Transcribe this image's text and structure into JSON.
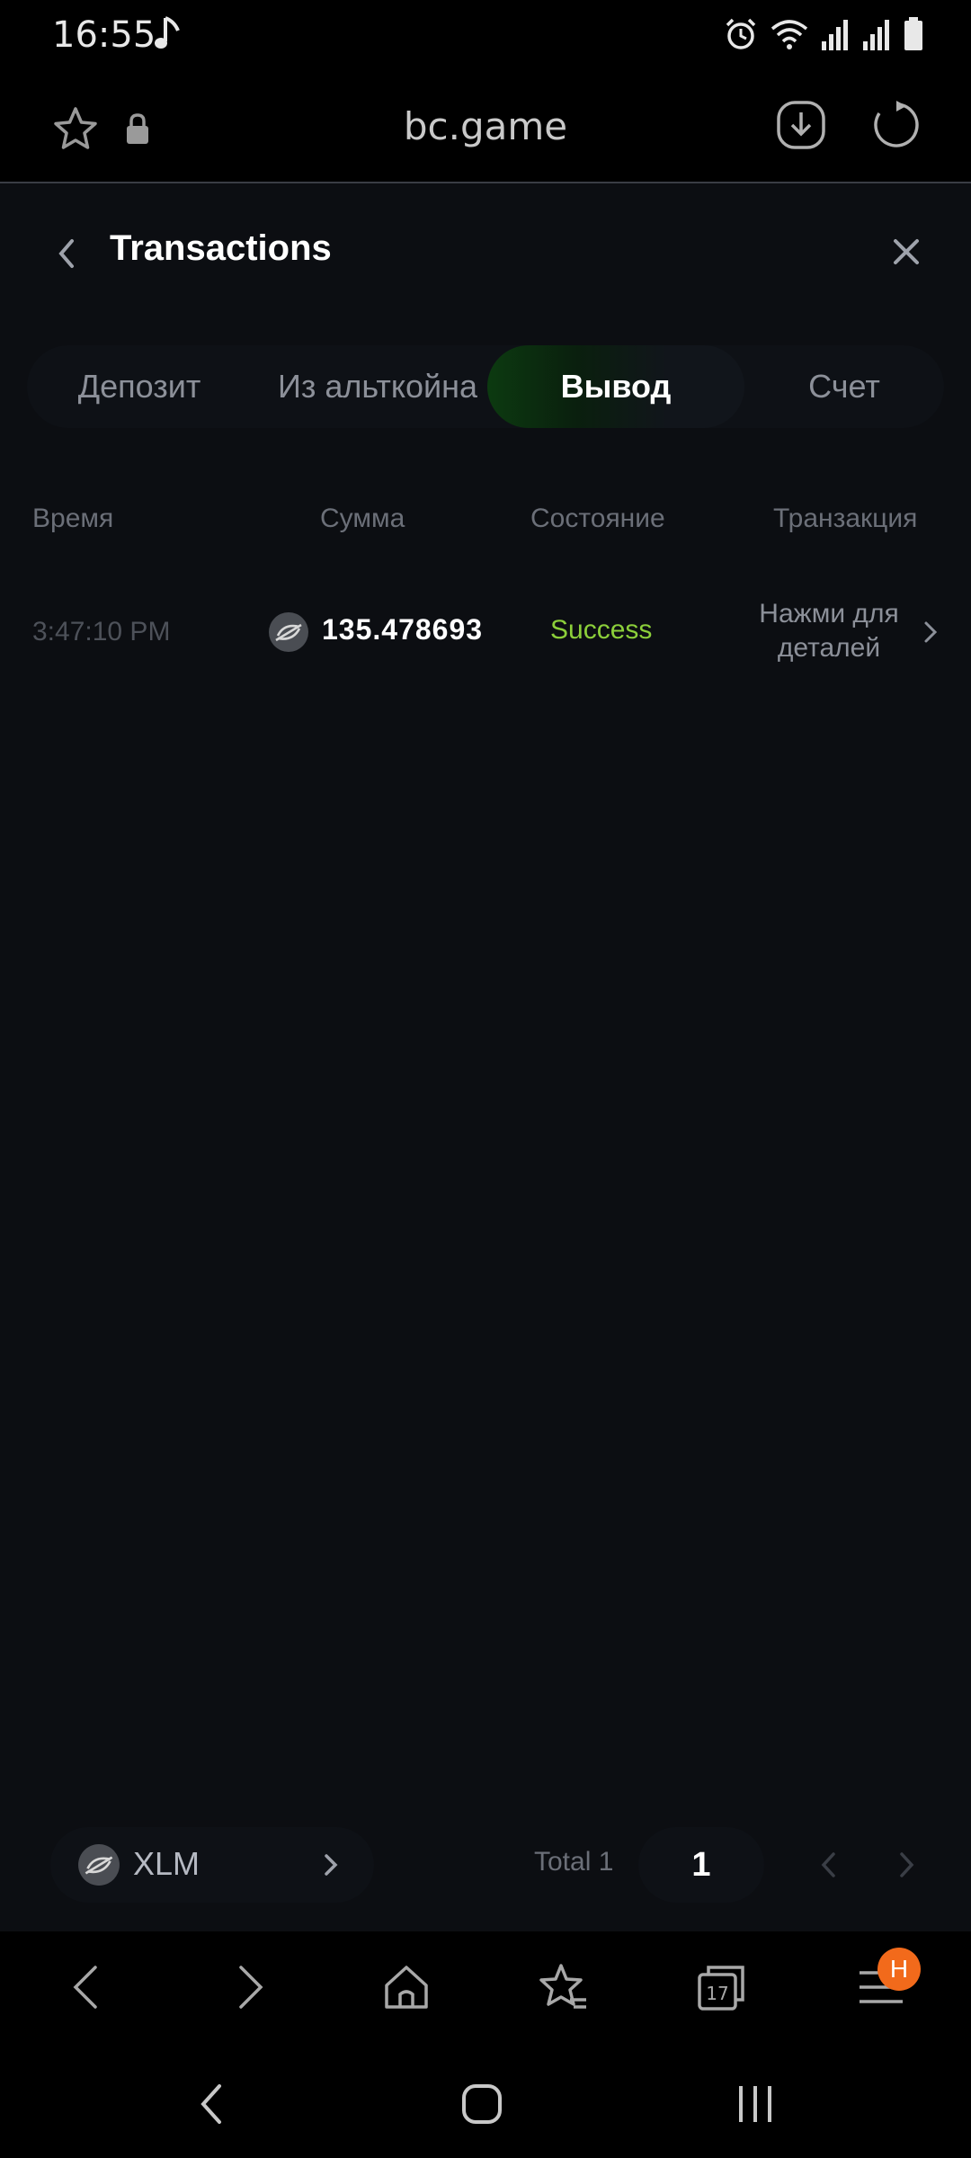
{
  "status_bar": {
    "time": "16:55"
  },
  "browser": {
    "url": "bc.game"
  },
  "header": {
    "title": "Transactions"
  },
  "tabs": [
    {
      "label": "Депозит"
    },
    {
      "label": "Из альткойна"
    },
    {
      "label": "Вывод",
      "active": true
    },
    {
      "label": "Счет"
    }
  ],
  "table": {
    "columns": [
      "Время",
      "Сумма",
      "Состояние",
      "Транзакция"
    ],
    "rows": [
      {
        "time": "3:47:10 PM",
        "amount": "135.478693",
        "state": "Success",
        "details": "Нажми для деталей"
      }
    ]
  },
  "pager": {
    "coin": "XLM",
    "total": "Total 1",
    "page": "1"
  },
  "toolbar": {
    "menu_badge": "H"
  },
  "colors": {
    "background": "#0c0e12",
    "success": "#8ccf3a",
    "active_tab_glow": "#0c3a10",
    "badge": "#f26a1b"
  }
}
